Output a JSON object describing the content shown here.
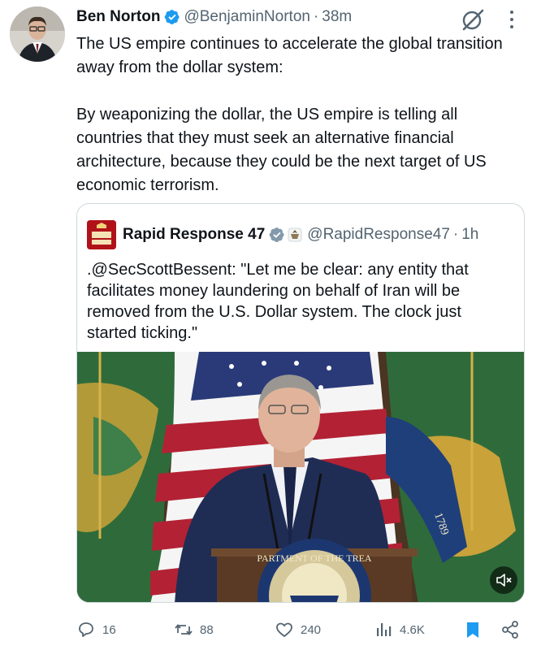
{
  "author": {
    "name": "Ben Norton",
    "handle": "@BenjaminNorton",
    "separator": "·",
    "time": "38m"
  },
  "tweet": {
    "text": "The US empire continues to accelerate the global transition away from the dollar system:\n\nBy weaponizing the dollar, the US empire is telling all countries that they must seek an alternative financial architecture, because they could be the next target of US economic terrorism."
  },
  "quote": {
    "name": "Rapid Response 47",
    "handle": "@RapidResponse47",
    "separator": "·",
    "time": "1h",
    "avatar_text": "RAPID RESPONSE",
    "text": ".@SecScottBessent: \"Let me be clear: any entity that facilitates money laundering on behalf of Iran will be removed from the U.S. Dollar system. The clock just started ticking.\"",
    "media": {
      "seal_text": "PARTMENT OF THE TREA",
      "flag_year": "1789",
      "mute_icon": "speaker-muted-icon"
    }
  },
  "actions": {
    "replies": "16",
    "reposts": "88",
    "likes": "240",
    "views": "4.6K"
  },
  "colors": {
    "verified": "#1d9bf0",
    "secondary_text": "#536471",
    "bookmark": "#1d9bf0",
    "border": "#cfd9de"
  },
  "icons": {
    "grok": "grok-icon",
    "more": "more-icon",
    "reply": "reply-icon",
    "repost": "repost-icon",
    "like": "heart-icon",
    "views": "views-chart-icon",
    "bookmark": "bookmark-icon",
    "share": "share-icon"
  }
}
